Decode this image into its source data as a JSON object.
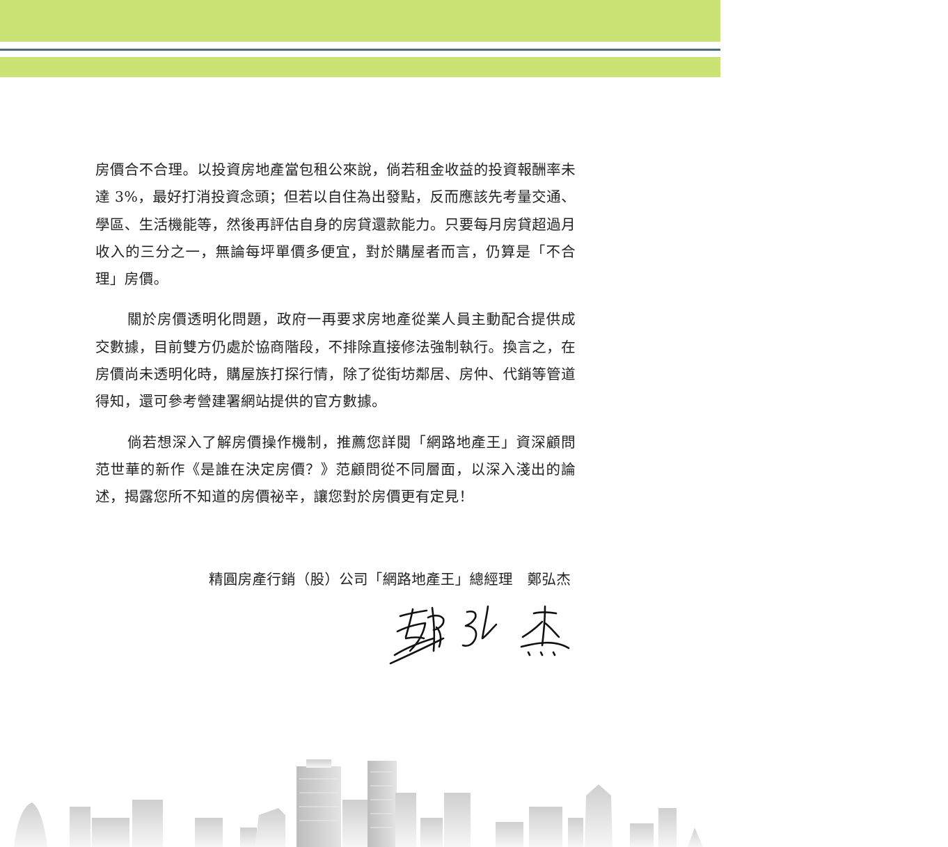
{
  "colors": {
    "band": "#cbe274",
    "rule": "#4b6b83"
  },
  "paragraphs": [
    "房價合不合理。以投資房地產當包租公來說，倘若租金收益的投資報酬率未達 3%，最好打消投資念頭；但若以自住為出發點，反而應該先考量交通、學區、生活機能等，然後再評估自身的房貸還款能力。只要每月房貸超過月收入的三分之一，無論每坪單價多便宜，對於購屋者而言，仍算是「不合理」房價。",
    "關於房價透明化問題，政府一再要求房地產從業人員主動配合提供成交數據，目前雙方仍處於協商階段，不排除直接修法強制執行。換言之，在房價尚未透明化時，購屋族打探行情，除了從街坊鄰居、房仲、代銷等管道得知，還可參考營建署網站提供的官方數據。",
    "倘若想深入了解房價操作機制，推薦您詳閱「網路地產王」資深顧問范世華的新作《是誰在決定房價？》范顧問從不同層面，以深入淺出的論述，揭露您所不知道的房價祕辛，讓您對於房價更有定見！"
  ],
  "signoff": "精圓房產行銷（股）公司「網路地產王」總經理　鄭弘杰",
  "signature_text": "鄭弘杰"
}
